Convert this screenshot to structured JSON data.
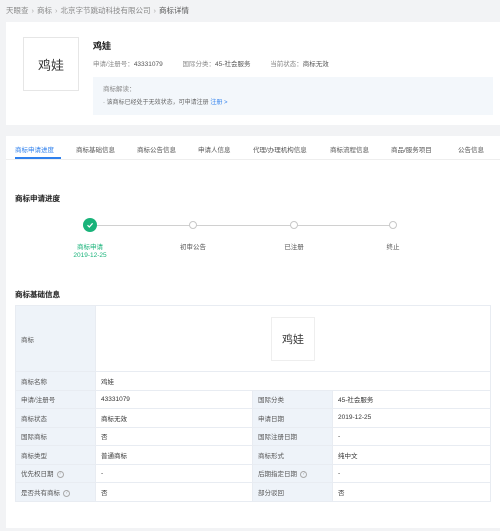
{
  "breadcrumb": [
    "天眼查",
    "商标",
    "北京字节跳动科技有限公司",
    "商标详情"
  ],
  "trademark": {
    "logo_text": "鸡娃",
    "name": "鸡娃",
    "reg_no_label": "申请/注册号：",
    "reg_no": "43331079",
    "intl_class_label": "国际分类：",
    "intl_class": "45-社会服务",
    "status_label": "当前状态：",
    "status": "商标无效"
  },
  "notice": {
    "title": "商标解读：",
    "text": "· 该商标已经处于无效状态，可申请注册",
    "link": "注册 >"
  },
  "tabs": [
    "商标申请进度",
    "商标基础信息",
    "商标公告信息",
    "申请人信息",
    "代理/办理机构信息",
    "商标流程信息",
    "商品/服务项目",
    "公告信息"
  ],
  "progress": {
    "section_title": "商标申请进度",
    "steps": [
      {
        "label": "商标申请",
        "date": "2019-12-25",
        "done": true
      },
      {
        "label": "初审公告",
        "done": false
      },
      {
        "label": "已注册",
        "done": false
      },
      {
        "label": "终止",
        "done": false
      }
    ]
  },
  "basic_info": {
    "section_title": "商标基础信息",
    "logo_label": "商标",
    "logo_text": "鸡娃",
    "name_label": "商标名称",
    "name": "鸡娃",
    "rows": [
      {
        "k1": "申请/注册号",
        "v1": "43331079",
        "k2": "国际分类",
        "v2": "45-社会服务"
      },
      {
        "k1": "商标状态",
        "v1": "商标无效",
        "k2": "申请日期",
        "v2": "2019-12-25"
      },
      {
        "k1": "国际商标",
        "v1": "否",
        "k2": "国际注册日期",
        "v2": "-"
      },
      {
        "k1": "商标类型",
        "v1": "普通商标",
        "k2": "商标形式",
        "v2": "纯中文"
      },
      {
        "k1": "优先权日期",
        "v1": "-",
        "k2": "后期指定日期",
        "v2": "-"
      },
      {
        "k1": "是否共有商标",
        "v1": "否",
        "k2": "部分驳回",
        "v2": "否"
      }
    ]
  },
  "colors": {
    "accent": "#2f80ed",
    "success": "#19b37a",
    "label_bg": "#eef3f9"
  }
}
